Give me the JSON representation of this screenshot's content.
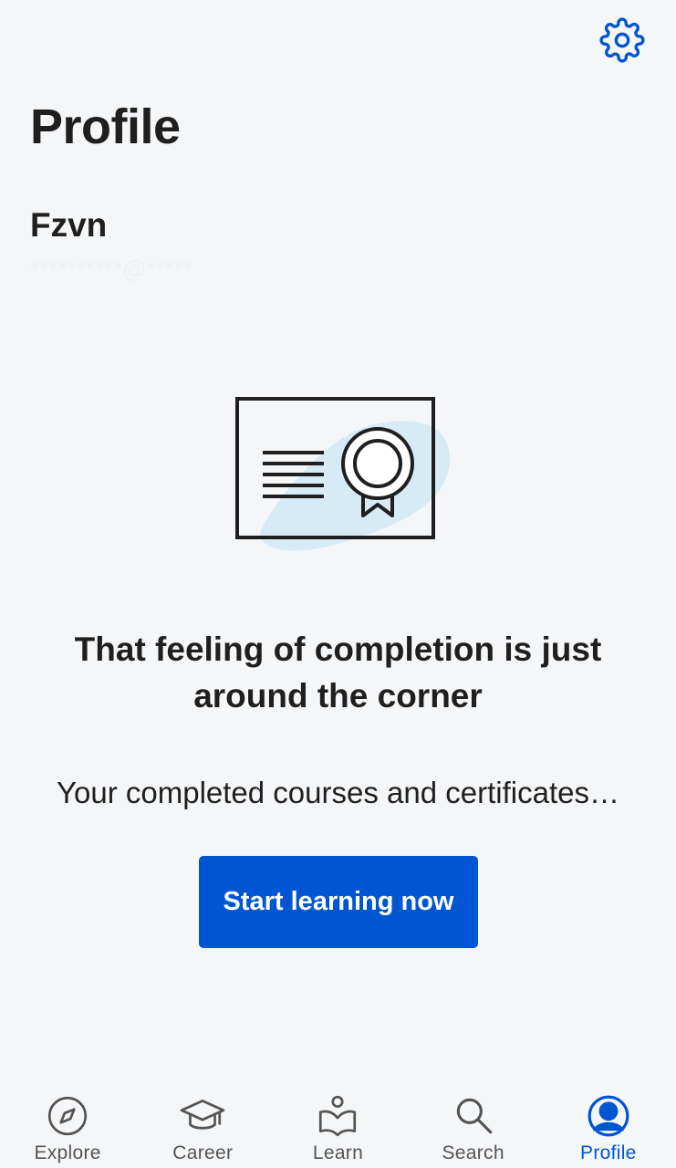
{
  "header": {
    "title": "Profile",
    "settings_icon": "gear-icon"
  },
  "user": {
    "name": "Fzvn",
    "email": "**********@*****"
  },
  "empty_state": {
    "illustration": "certificate-icon",
    "headline": "That feeling of completion is just around the corner",
    "subtext": "Your completed courses and certificates…",
    "cta_label": "Start learning now"
  },
  "bottom_nav": {
    "items": [
      {
        "label": "Explore",
        "icon": "compass-icon"
      },
      {
        "label": "Career",
        "icon": "graduation-cap-icon"
      },
      {
        "label": "Learn",
        "icon": "book-person-icon"
      },
      {
        "label": "Search",
        "icon": "search-icon"
      },
      {
        "label": "Profile",
        "icon": "user-circle-icon",
        "active": true
      }
    ]
  },
  "colors": {
    "background": "#f5f6f8",
    "accent": "#0056d2",
    "text": "#1f1f1f",
    "nav_inactive": "#545454",
    "illustration_blob": "#d6ebf6"
  }
}
